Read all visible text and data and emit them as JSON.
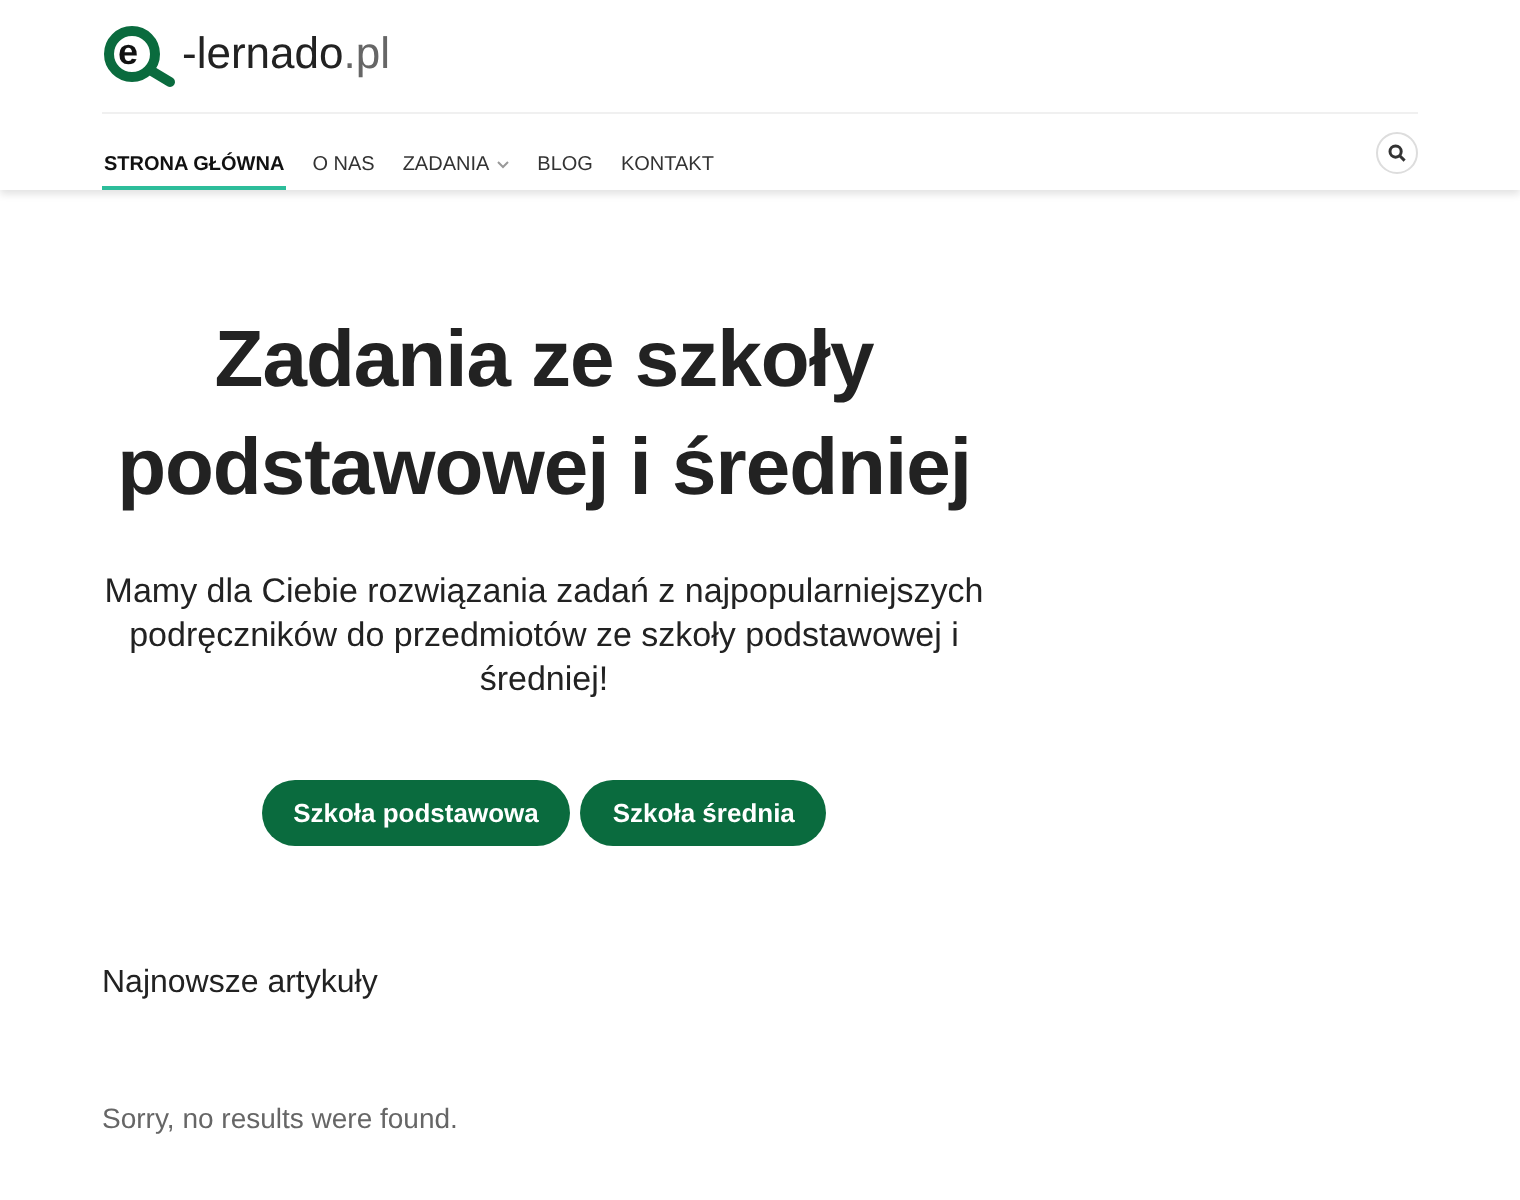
{
  "logo": {
    "letter": "e",
    "name": "-lernado",
    "domain": ".pl"
  },
  "nav": [
    {
      "label": "STRONA GŁÓWNA",
      "selected": true,
      "has_menu": false
    },
    {
      "label": "O NAS",
      "selected": false,
      "has_menu": false
    },
    {
      "label": "ZADANIA",
      "selected": false,
      "has_menu": true
    },
    {
      "label": "BLOG",
      "selected": false,
      "has_menu": false
    },
    {
      "label": "KONTAKT",
      "selected": false,
      "has_menu": false
    }
  ],
  "hero": {
    "title": "Zadania ze szkoły podstawowej i średniej",
    "subtitle": "Mamy dla Ciebie rozwiązania zadań z najpopularniejszych podręczników do przedmiotów ze szkoły podstawowej i średniej!",
    "buttons": [
      "Szkoła podstawowa",
      "Szkoła średnia"
    ]
  },
  "articles": {
    "heading": "Najnowsze artykuły",
    "empty_message": "Sorry, no results were found."
  }
}
